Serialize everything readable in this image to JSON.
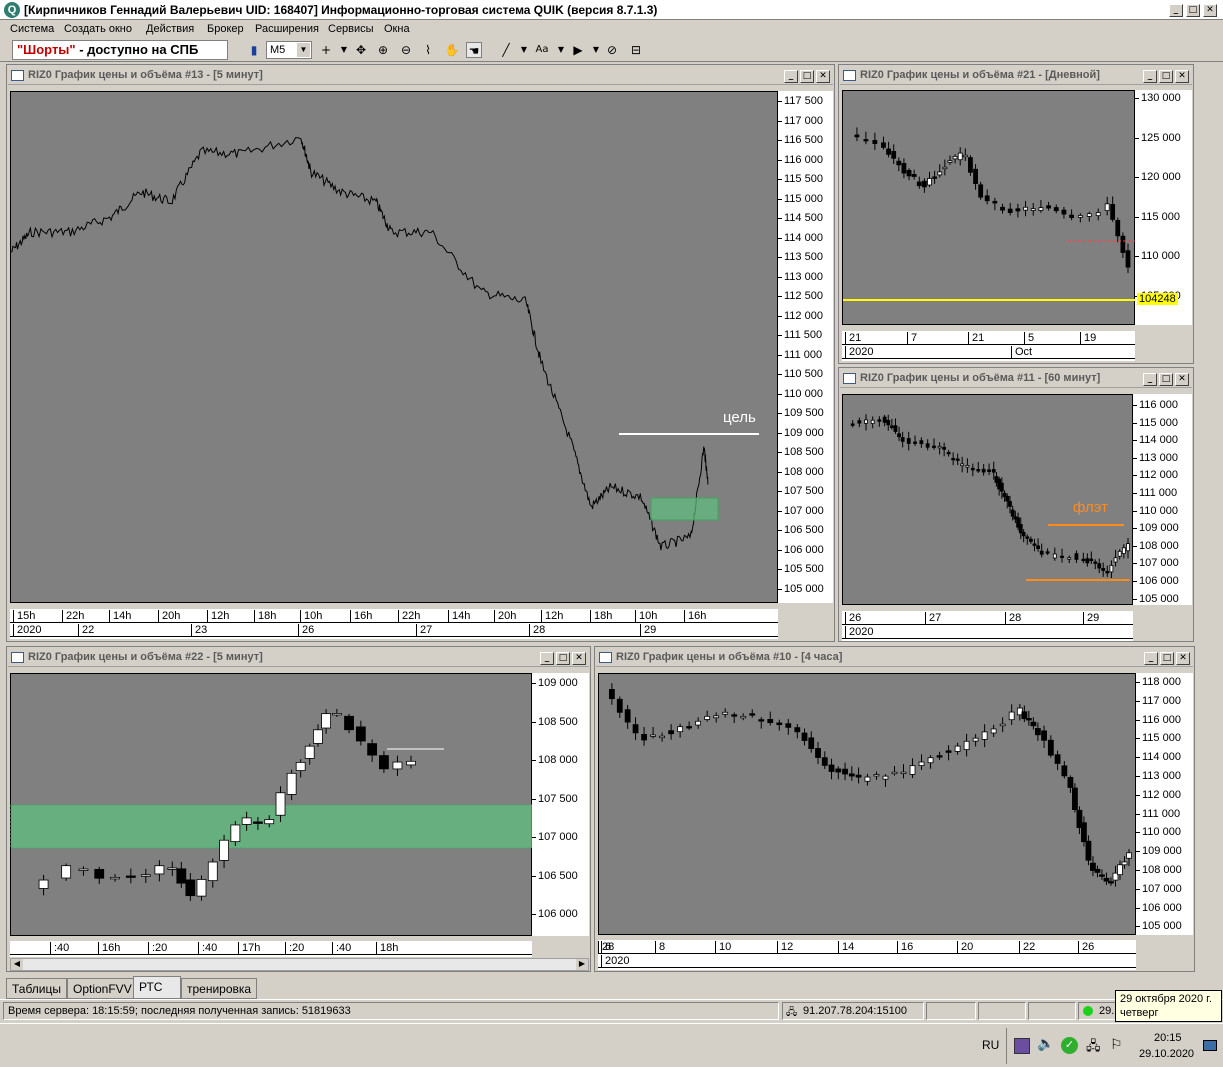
{
  "window": {
    "title": "[Кирпичников Геннадий Валерьевич UID: 168407] Информационно-торговая система QUIK (версия 8.7.1.3)",
    "logo": "Q"
  },
  "menu": [
    "Система",
    "Создать окно",
    "Действия",
    "Брокер",
    "Расширения",
    "Сервисы",
    "Окна"
  ],
  "toolbar": {
    "notice_quoted": "\"Шорты\"",
    "notice_rest": " - доступно на СПБ",
    "interval_value": "M5"
  },
  "charts": [
    {
      "id": "c13",
      "title": "RIZ0 График цены и объёма #13 - [5 минут]",
      "yticks": [
        "117 500",
        "117 000",
        "116 500",
        "116 000",
        "115 500",
        "115 000",
        "114 500",
        "114 000",
        "113 500",
        "113 000",
        "112 500",
        "112 000",
        "111 500",
        "111 000",
        "110 500",
        "110 000",
        "109 500",
        "109 000",
        "108 500",
        "108 000",
        "107 500",
        "107 000",
        "106 500",
        "106 000",
        "105 500",
        "105 000"
      ],
      "xrow1": [
        "15h",
        "22h",
        "14h",
        "20h",
        "12h",
        "18h",
        "10h",
        "16h",
        "22h",
        "14h",
        "20h",
        "12h",
        "18h",
        "10h",
        "16h"
      ],
      "xrow2": [
        "2020",
        "22",
        "23",
        "26",
        "27",
        "28",
        "29"
      ],
      "annotation": "цель"
    },
    {
      "id": "c21",
      "title": "RIZ0 График цены и объёма #21 - [Дневной]",
      "yticks": [
        "130 000",
        "125 000",
        "120 000",
        "115 000",
        "110 000",
        "105 000"
      ],
      "price_label": "104248",
      "xrow1": [
        "21",
        "7",
        "21",
        "5",
        "19"
      ],
      "xrow2": [
        "2020",
        "Oct"
      ]
    },
    {
      "id": "c11",
      "title": "RIZ0 График цены и объёма #11 - [60 минут]",
      "yticks": [
        "116 000",
        "115 000",
        "114 000",
        "113 000",
        "112 000",
        "111 000",
        "110 000",
        "109 000",
        "108 000",
        "107 000",
        "106 000",
        "105 000"
      ],
      "xrow1": [
        "26",
        "27",
        "28",
        "29"
      ],
      "xrow2": [
        "2020"
      ],
      "annotation": "флэт"
    },
    {
      "id": "c22",
      "title": "RIZ0 График цены и объёма #22 - [5 минут]",
      "yticks": [
        "109 000",
        "108 500",
        "108 000",
        "107 500",
        "107 000",
        "106 500",
        "106 000"
      ],
      "xrow1": [
        ":40",
        "16h",
        ":20",
        ":40",
        "17h",
        ":20",
        ":40",
        "18h"
      ]
    },
    {
      "id": "c10",
      "title": "RIZ0 График цены и объёма #10 - [4 часа]",
      "yticks": [
        "118 000",
        "117 000",
        "116 000",
        "115 000",
        "114 000",
        "113 000",
        "112 000",
        "111 000",
        "110 000",
        "109 000",
        "108 000",
        "107 000",
        "106 000",
        "105 000"
      ],
      "xrow1": [
        "6",
        "8",
        "10",
        "12",
        "14",
        "16",
        "20",
        "22",
        "26",
        "28"
      ],
      "xrow2": [
        "2020"
      ]
    }
  ],
  "tabs": [
    "Таблицы",
    "OptionFVV",
    "РТС",
    "тренировка"
  ],
  "status": {
    "server": "Время сервера: 18:15:59; последняя полученная запись: 51819633",
    "connection": "91.207.78.204:15100",
    "date_short": "29."
  },
  "tooltip": {
    "line1": "29 октября 2020 г.",
    "line2": "четверг"
  },
  "taskbar": {
    "lang": "RU",
    "time": "20:15",
    "date": "29.10.2020"
  },
  "colors": {
    "plot_bg": "#808080",
    "candle_up": "#ffffff",
    "candle_down": "#000000",
    "zone": "#5fbf7f",
    "orange": "#ff8c1a",
    "target": "#ffffff",
    "yellow": "#ffff00"
  }
}
